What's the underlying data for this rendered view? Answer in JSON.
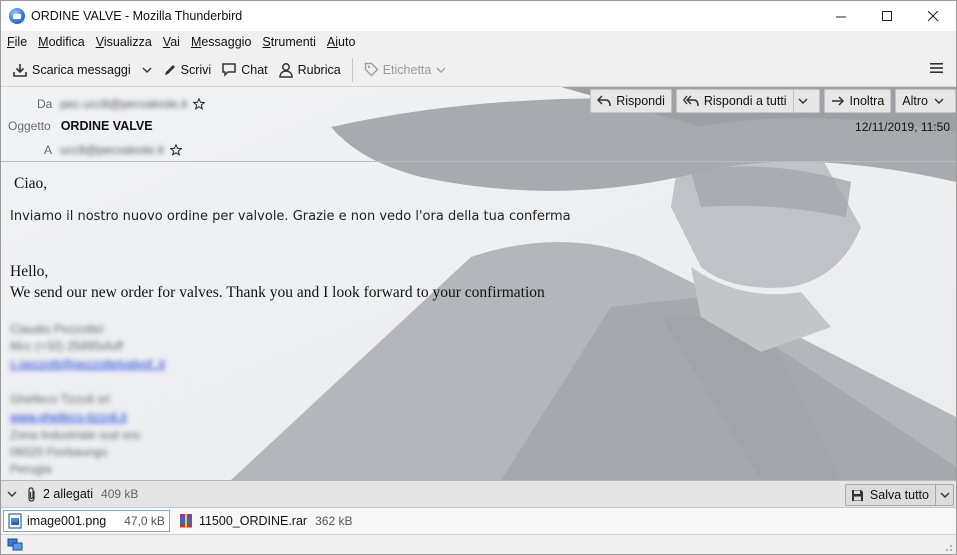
{
  "window": {
    "title": "ORDINE VALVE - Mozilla Thunderbird",
    "minimize": "—",
    "maximize": "☐",
    "close": "✕"
  },
  "menu": {
    "items": [
      {
        "first": "F",
        "rest": "ile"
      },
      {
        "first": "M",
        "rest": "odifica"
      },
      {
        "first": "V",
        "rest": "isualizza"
      },
      {
        "first": "V",
        "rest": "ai"
      },
      {
        "first": "M",
        "rest": "essaggio"
      },
      {
        "first": "S",
        "rest": "trumenti"
      },
      {
        "first": "Ai",
        "rest": "uto"
      }
    ]
  },
  "toolbar": {
    "get_messages": "Scarica messaggi",
    "write": "Scrivi",
    "chat": "Chat",
    "address_book": "Rubrica",
    "tag": "Etichetta"
  },
  "header": {
    "from_label": "Da",
    "from_value": "pec-ucc8@pecvalvole.it",
    "subject_label": "Oggetto",
    "subject_value": "ORDINE VALVE",
    "to_label": "A",
    "to_value": "ucc8@pecvalvole.it",
    "date": "12/11/2019, 11:50",
    "actions": {
      "reply": "Rispondi",
      "reply_all": "Rispondi a tutti",
      "forward": "Inoltra",
      "more": "Altro"
    }
  },
  "body": {
    "greeting_it": "Ciao,",
    "line_it": "Inviamo il nostro nuovo ordine per valvole. Grazie e non vedo l'ora della tua conferma",
    "greeting_en": "Hello,",
    "line_en": "We send our new order  for valves. Thank you and I look forward to your confirmation",
    "signature": {
      "name": "Claudio Pezzottel",
      "phone": "Mcc (+32) 25895xfuff",
      "email": "c.pezzotti@pezzottelvalvof..it",
      "company": "Ghelleco Tizzoli srl",
      "website": "www.ghelleco-tizzoli.it",
      "street": "Zona Industriale sud snc",
      "zip": "06020 Fiorbaungo",
      "city": "Perugia"
    }
  },
  "attachments": {
    "count_label": "2 allegati",
    "total_size": "409 kB",
    "save_all": "Salva tutto",
    "files": [
      {
        "name": "image001.png",
        "size": "47,0 kB",
        "icon": "image-file-icon"
      },
      {
        "name": "11500_ORDINE.rar",
        "size": "362 kB",
        "icon": "rar-archive-icon"
      }
    ]
  },
  "colors": {
    "chrome": "#f0f0f0",
    "content_bg": "#eef0f3",
    "link": "#1a3cdc"
  }
}
